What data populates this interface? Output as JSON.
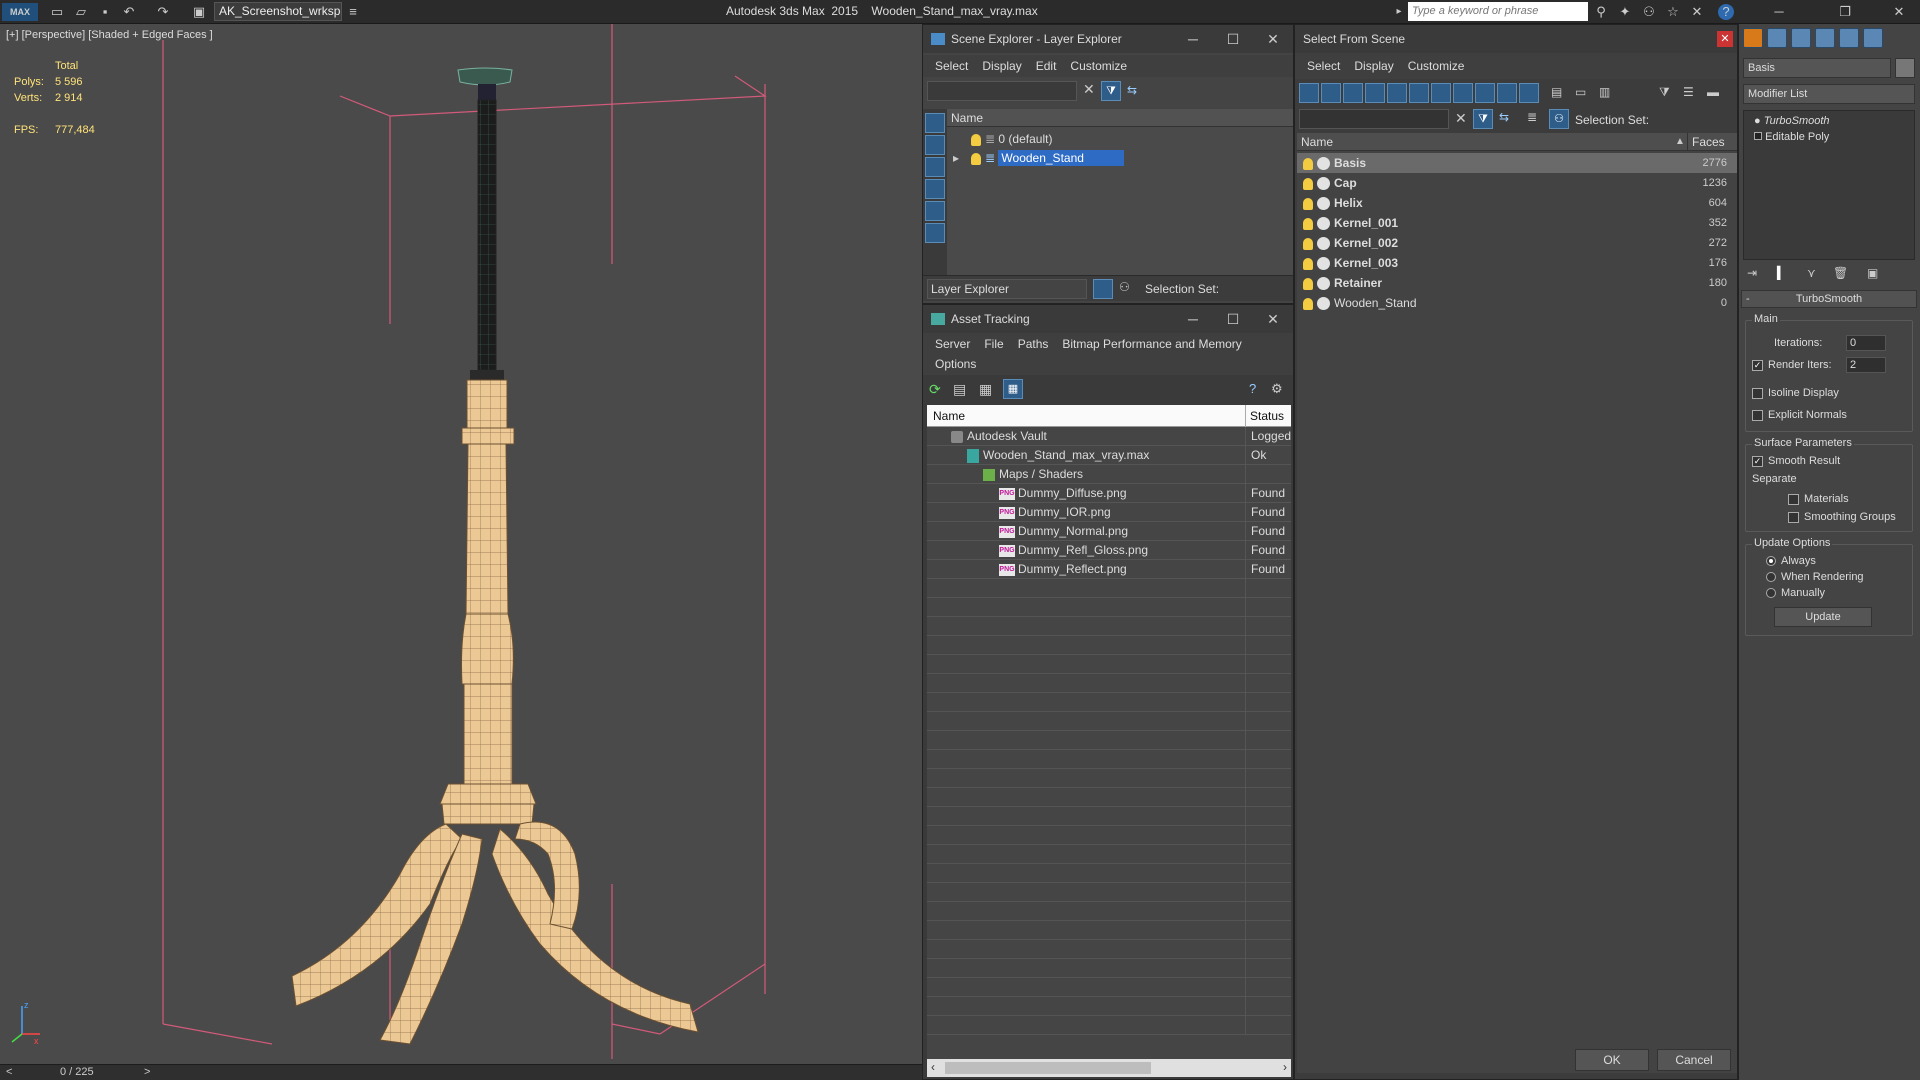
{
  "app": {
    "title": "Autodesk 3ds Max  2015    Wooden_Stand_max_vray.max",
    "workspace": "AK_Screenshot_wrksp",
    "logo": "MAX",
    "search_placeholder": "Type a keyword or phrase"
  },
  "viewport": {
    "label": "[+] [Perspective] [Shaded + Edged Faces ]",
    "stats": {
      "total_label": "Total",
      "polys_label": "Polys:",
      "polys": "5 596",
      "verts_label": "Verts:",
      "verts": "2 914",
      "fps_label": "FPS:",
      "fps": "777,484"
    },
    "mesh_color": "#ecc895",
    "frame": "0 / 225",
    "prev": "<",
    "next": ">"
  },
  "scene_explorer": {
    "title": "Scene Explorer - Layer Explorer",
    "menu": [
      "Select",
      "Display",
      "Edit",
      "Customize"
    ],
    "column": "Name",
    "rows": [
      {
        "label": "0 (default)",
        "selected": false
      },
      {
        "label": "Wooden_Stand",
        "selected": true
      }
    ],
    "footer_label": "Layer Explorer",
    "selection_set": "Selection Set:"
  },
  "asset_tracking": {
    "title": "Asset Tracking",
    "menu": [
      "Server",
      "File",
      "Paths",
      "Bitmap Performance and Memory"
    ],
    "menu2": "Options",
    "col_name": "Name",
    "col_status": "Status",
    "rows": [
      {
        "name": "Autodesk Vault",
        "status": "Logged",
        "indent": 0,
        "icon": "vault"
      },
      {
        "name": "Wooden_Stand_max_vray.max",
        "status": "Ok",
        "indent": 1,
        "icon": "max"
      },
      {
        "name": "Maps / Shaders",
        "status": "",
        "indent": 2,
        "icon": "maps"
      },
      {
        "name": "Dummy_Diffuse.png",
        "status": "Found",
        "indent": 3,
        "icon": "png"
      },
      {
        "name": "Dummy_IOR.png",
        "status": "Found",
        "indent": 3,
        "icon": "png"
      },
      {
        "name": "Dummy_Normal.png",
        "status": "Found",
        "indent": 3,
        "icon": "png"
      },
      {
        "name": "Dummy_Refl_Gloss.png",
        "status": "Found",
        "indent": 3,
        "icon": "png"
      },
      {
        "name": "Dummy_Reflect.png",
        "status": "Found",
        "indent": 3,
        "icon": "png"
      }
    ],
    "png_badge": "PNG"
  },
  "select_from_scene": {
    "title": "Select From Scene",
    "menu": [
      "Select",
      "Display",
      "Customize"
    ],
    "selection_set": "Selection Set:",
    "col_name": "Name",
    "col_faces": "Faces",
    "rows": [
      {
        "name": "Basis",
        "faces": "2776",
        "bold": true,
        "selected": true
      },
      {
        "name": "Cap",
        "faces": "1236",
        "bold": true,
        "selected": false
      },
      {
        "name": "Helix",
        "faces": "604",
        "bold": true,
        "selected": false
      },
      {
        "name": "Kernel_001",
        "faces": "352",
        "bold": true,
        "selected": false
      },
      {
        "name": "Kernel_002",
        "faces": "272",
        "bold": true,
        "selected": false
      },
      {
        "name": "Kernel_003",
        "faces": "176",
        "bold": true,
        "selected": false
      },
      {
        "name": "Retainer",
        "faces": "180",
        "bold": true,
        "selected": false
      },
      {
        "name": "Wooden_Stand",
        "faces": "0",
        "bold": false,
        "selected": false
      }
    ],
    "ok": "OK",
    "cancel": "Cancel"
  },
  "command_panel": {
    "object_name": "Basis",
    "modifier_list": "Modifier List",
    "stack": [
      "TurboSmooth",
      "Editable Poly"
    ],
    "rollout": "TurboSmooth",
    "main": "Main",
    "iterations_label": "Iterations:",
    "iterations": "0",
    "render_iters_label": "Render Iters:",
    "render_iters": "2",
    "isoline": "Isoline Display",
    "explicit_normals": "Explicit Normals",
    "surface_params": "Surface Parameters",
    "smooth_result": "Smooth Result",
    "separate": "Separate",
    "materials": "Materials",
    "smoothing_groups": "Smoothing Groups",
    "update_options": "Update Options",
    "always": "Always",
    "when_rendering": "When Rendering",
    "manually": "Manually",
    "update": "Update",
    "collapse": "-"
  }
}
